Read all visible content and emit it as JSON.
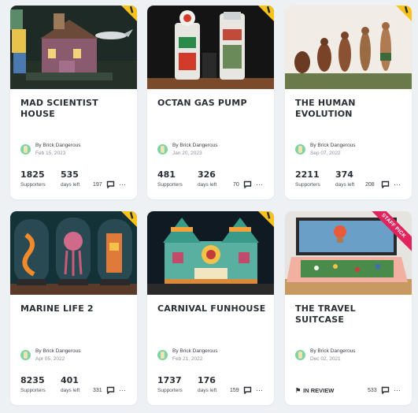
{
  "colors": {
    "accent_flag": "#f7c21a",
    "staff_pick": "#e0245e",
    "avatar": "#7fd3a5",
    "page_background": "#eef1f4"
  },
  "labels": {
    "supporters": "Supporters",
    "days_left": "days left",
    "in_review": "IN REVIEW",
    "staff_pick": "STAFF PICK"
  },
  "projects": [
    {
      "title": "MAD SCIENTIST HOUSE",
      "author": "By Brick Dangerous",
      "date": "Feb 15, 2023",
      "supporters": "1825",
      "days_left": "535",
      "comments": "197",
      "image": "mad-scientist-house-image"
    },
    {
      "title": "OCTAN GAS PUMP",
      "author": "By Brick Dangerous",
      "date": "Jan 20, 2023",
      "supporters": "481",
      "days_left": "326",
      "comments": "70",
      "image": "octan-gas-pump-image"
    },
    {
      "title": "THE HUMAN EVOLUTION",
      "author": "By Brick Dangerous",
      "date": "Sep 07, 2022",
      "supporters": "2211",
      "days_left": "374",
      "comments": "208",
      "image": "human-evolution-image"
    },
    {
      "title": "MARINE LIFE 2",
      "author": "By Brick Dangerous",
      "date": "Apr 05, 2022",
      "supporters": "8235",
      "days_left": "401",
      "comments": "331",
      "image": "marine-life-image"
    },
    {
      "title": "CARNIVAL FUNHOUSE",
      "author": "By Brick Dangerous",
      "date": "Feb 21, 2022",
      "supporters": "1737",
      "days_left": "176",
      "comments": "159",
      "image": "carnival-funhouse-image"
    },
    {
      "title": "THE TRAVEL SUITCASE",
      "author": "By Brick Dangerous",
      "date": "Dec 02, 2021",
      "status": "IN REVIEW",
      "comments": "533",
      "staff_pick": true,
      "image": "travel-suitcase-image"
    }
  ]
}
